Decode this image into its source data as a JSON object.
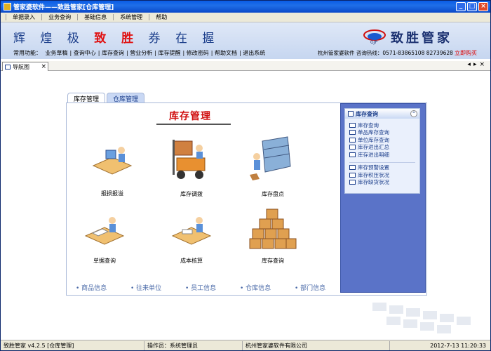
{
  "window": {
    "title": "管家婆软件——致胜管家[仓库管理]"
  },
  "menu": [
    "单据录入",
    "业务查询",
    "基础信息",
    "系统管理",
    "帮助"
  ],
  "banner": {
    "slogan_pre": "辉 煌 极",
    "slogan_mid": "致 胜",
    "slogan_post": "券 在 握",
    "brand": "致胜管家",
    "func_label": "常用功能：",
    "funcs": [
      "业务草稿",
      "查询中心",
      "库存查询",
      "营业分析",
      "库存提醒",
      "修改密码",
      "帮助文档",
      "退出系统"
    ],
    "company": "杭州管家婆软件  咨询热线：0571-83865108 82739628",
    "buy": "立即购买"
  },
  "tabs": {
    "nav_label": "导航图"
  },
  "panel": {
    "tab_active": "库存管理",
    "tab_inactive": "仓库管理",
    "title": "库存管理",
    "items": [
      {
        "label": "报损报溢"
      },
      {
        "label": "库存调拨"
      },
      {
        "label": "库存盘点"
      },
      {
        "label": "单据查询"
      },
      {
        "label": "成本核算"
      },
      {
        "label": "库存查询"
      }
    ],
    "links": [
      "• 商品信息",
      "• 往来单位",
      "• 员工信息",
      "• 仓库信息",
      "• 部门信息"
    ]
  },
  "sidebar": {
    "title": "库存查询",
    "group1": [
      "库存查询",
      "单品库存查询",
      "单位库存查询",
      "库存进出汇总",
      "库存进出明细"
    ],
    "group2": [
      "库存预警设置",
      "库存积压状况",
      "库存缺货状况"
    ]
  },
  "status": {
    "version": "致胜管家 v4.2.5 [仓库管理]",
    "operator": "操作员：系统管理员",
    "company": "杭州管家婆软件有限公司",
    "datetime": "2012-7-13 11:20:33"
  },
  "colors": {
    "accent": "#0a5ce6",
    "brand_red": "#d01010",
    "side_bg": "#5a73c8"
  }
}
